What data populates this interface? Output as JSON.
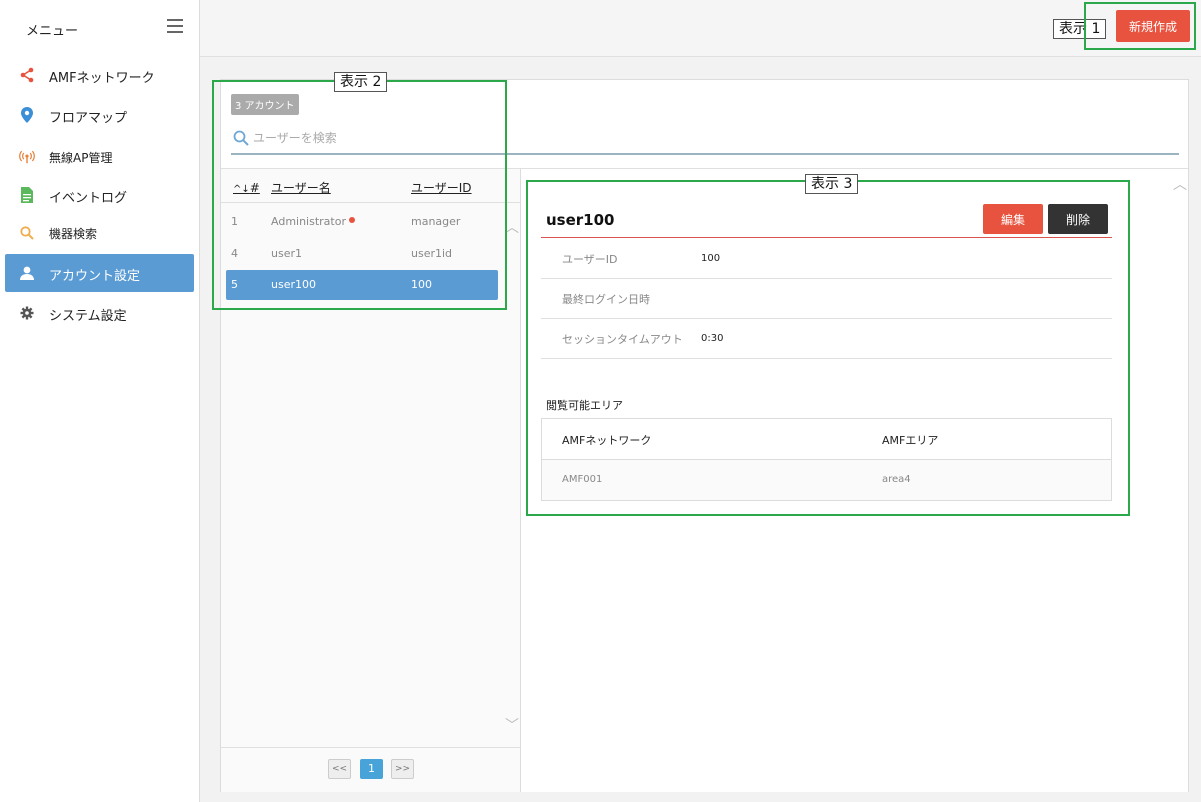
{
  "sidebar": {
    "title": "メニュー",
    "items": [
      {
        "label": "AMFネットワーク",
        "icon": "share-icon"
      },
      {
        "label": "フロアマップ",
        "icon": "map-pin-icon"
      },
      {
        "label": "無線AP管理",
        "icon": "wireless-icon"
      },
      {
        "label": "イベントログ",
        "icon": "document-icon"
      },
      {
        "label": "機器検索",
        "icon": "search-icon"
      },
      {
        "label": "アカウント設定",
        "icon": "user-icon"
      },
      {
        "label": "システム設定",
        "icon": "gear-icon"
      }
    ],
    "active_index": 5
  },
  "callouts": {
    "one": "表示 1",
    "two": "表示 2",
    "three": "表示 3"
  },
  "toolbar": {
    "new_label": "新規作成"
  },
  "list": {
    "count_badge": "3 アカウント",
    "search_placeholder": "ユーザーを検索",
    "headers": {
      "sort": "^↓",
      "num": "#",
      "name": "ユーザー名",
      "id": "ユーザーID"
    },
    "rows": [
      {
        "num": "1",
        "name": "Administrator",
        "id": "manager"
      },
      {
        "num": "4",
        "name": "user1",
        "id": "user1id"
      },
      {
        "num": "5",
        "name": "user100",
        "id": "100"
      }
    ],
    "selected_index": 2,
    "pager": {
      "prev": "<<",
      "page": "1",
      "next": ">>"
    }
  },
  "detail": {
    "title": "user100",
    "edit_label": "編集",
    "delete_label": "削除",
    "fields": [
      {
        "label": "ユーザーID",
        "value": "100"
      },
      {
        "label": "最終ログイン日時",
        "value": ""
      },
      {
        "label": "セッションタイムアウト",
        "value": "0:30"
      }
    ],
    "area_title": "閲覧可能エリア",
    "area_headers": {
      "network": "AMFネットワーク",
      "area": "AMFエリア"
    },
    "area_rows": [
      {
        "network": "AMF001",
        "area": "area4"
      }
    ]
  },
  "colors": {
    "accent_red": "#e8533f",
    "selected_blue": "#5a9bd4",
    "callout_green": "#2aa84a"
  }
}
